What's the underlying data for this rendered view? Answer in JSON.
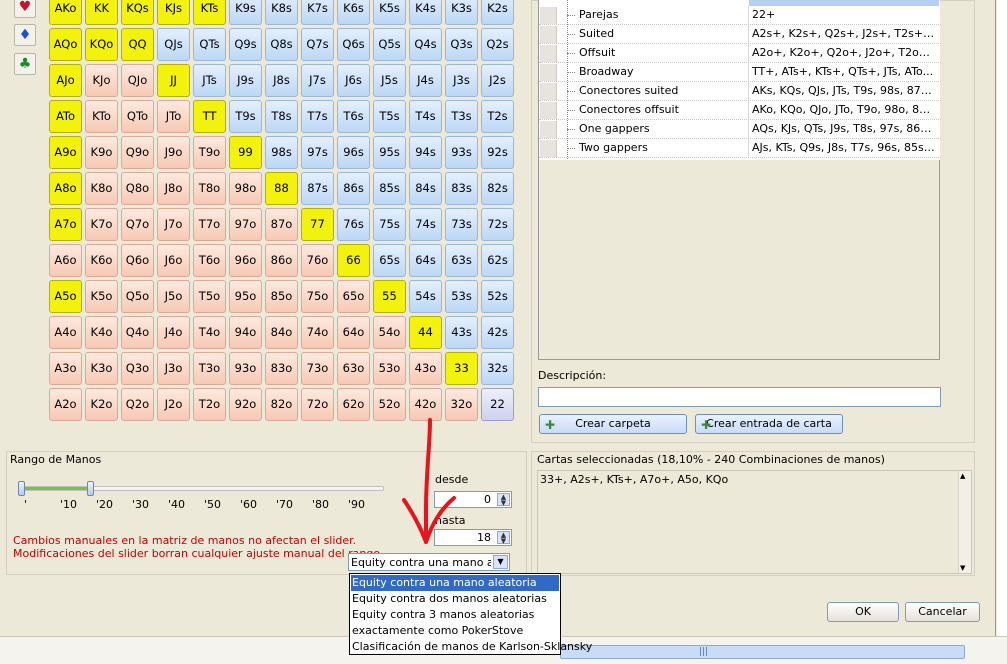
{
  "suit_buttons": [
    {
      "name": "hearts-icon",
      "glyph": "♥",
      "color": "#c8102e"
    },
    {
      "name": "diamonds-icon",
      "glyph": "♦",
      "color": "#1f4fd6"
    },
    {
      "name": "clubs-icon",
      "glyph": "♣",
      "color": "#1a8a2b"
    }
  ],
  "matrix": {
    "rows": [
      [
        "AKo",
        "KK",
        "KQs",
        "KJs",
        "KTs",
        "K9s",
        "K8s",
        "K7s",
        "K6s",
        "K5s",
        "K4s",
        "K3s",
        "K2s"
      ],
      [
        "AQo",
        "KQo",
        "QQ",
        "QJs",
        "QTs",
        "Q9s",
        "Q8s",
        "Q7s",
        "Q6s",
        "Q5s",
        "Q4s",
        "Q3s",
        "Q2s"
      ],
      [
        "AJo",
        "KJo",
        "QJo",
        "JJ",
        "JTs",
        "J9s",
        "J8s",
        "J7s",
        "J6s",
        "J5s",
        "J4s",
        "J3s",
        "J2s"
      ],
      [
        "ATo",
        "KTo",
        "QTo",
        "JTo",
        "TT",
        "T9s",
        "T8s",
        "T7s",
        "T6s",
        "T5s",
        "T4s",
        "T3s",
        "T2s"
      ],
      [
        "A9o",
        "K9o",
        "Q9o",
        "J9o",
        "T9o",
        "99",
        "98s",
        "97s",
        "96s",
        "95s",
        "94s",
        "93s",
        "92s"
      ],
      [
        "A8o",
        "K8o",
        "Q8o",
        "J8o",
        "T8o",
        "98o",
        "88",
        "87s",
        "86s",
        "85s",
        "84s",
        "83s",
        "82s"
      ],
      [
        "A7o",
        "K7o",
        "Q7o",
        "J7o",
        "T7o",
        "97o",
        "87o",
        "77",
        "76s",
        "75s",
        "74s",
        "73s",
        "72s"
      ],
      [
        "A6o",
        "K6o",
        "Q6o",
        "J6o",
        "T6o",
        "96o",
        "86o",
        "76o",
        "66",
        "65s",
        "64s",
        "63s",
        "62s"
      ],
      [
        "A5o",
        "K5o",
        "Q5o",
        "J5o",
        "T5o",
        "95o",
        "85o",
        "75o",
        "65o",
        "55",
        "54s",
        "53s",
        "52s"
      ],
      [
        "A4o",
        "K4o",
        "Q4o",
        "J4o",
        "T4o",
        "94o",
        "84o",
        "74o",
        "64o",
        "54o",
        "44",
        "43s",
        "42s"
      ],
      [
        "A3o",
        "K3o",
        "Q3o",
        "J3o",
        "T3o",
        "93o",
        "83o",
        "73o",
        "63o",
        "53o",
        "43o",
        "33",
        "32s"
      ],
      [
        "A2o",
        "K2o",
        "Q2o",
        "J2o",
        "T2o",
        "92o",
        "82o",
        "72o",
        "62o",
        "52o",
        "42o",
        "32o",
        "22"
      ]
    ],
    "selected": [
      "AKo",
      "KK",
      "KQs",
      "KJs",
      "KTs",
      "AQo",
      "KQo",
      "QQ",
      "AJo",
      "JJ",
      "ATo",
      "TT",
      "A9o",
      "99",
      "A8o",
      "88",
      "A7o",
      "77",
      "66",
      "A5o",
      "55",
      "44",
      "33"
    ],
    "colors": {
      "selected": "#f2f20c",
      "pair": "#d6daf2",
      "suited": "#c5dcf5",
      "offsuit": "#f8d0bd"
    }
  },
  "tree": {
    "rows": [
      {
        "name": "Parejas",
        "value": "22+"
      },
      {
        "name": "Suited",
        "value": "A2s+, K2s+, Q2s+, J2s+, T2s+, 9..."
      },
      {
        "name": "Offsuit",
        "value": "A2o+, K2o+, Q2o+, J2o+, T2o+, ..."
      },
      {
        "name": "Broadway",
        "value": "TT+, ATs+, KTs+, QTs+, JTs, ATo..."
      },
      {
        "name": "Conectores suited",
        "value": "AKs, KQs, QJs, JTs, T9s, 98s, 87s, ..."
      },
      {
        "name": "Conectores offsuit",
        "value": "AKo, KQo, QJo, JTo, T9o, 98o, 87o..."
      },
      {
        "name": "One gappers",
        "value": "AQs, KJs, QTs, J9s, T8s, 97s, 86s, ..."
      },
      {
        "name": "Two gappers",
        "value": "AJs, KTs, Q9s, J8s, T7s, 96s, 85s, ..."
      }
    ]
  },
  "description": {
    "label": "Descripción:",
    "value": ""
  },
  "buttons": {
    "create_folder": "Crear carpeta",
    "create_entry": "Crear entrada de carta",
    "ok": "OK",
    "cancel": "Cancelar"
  },
  "range": {
    "title": "Rango de Manos",
    "ticks": [
      "10",
      "20",
      "30",
      "40",
      "50",
      "60",
      "70",
      "80",
      "90"
    ],
    "from_label": "desde",
    "from_value": "0",
    "to_label": "hasta",
    "to_value": "18",
    "warning_line1": "Cambios manuales en la matriz de manos no afectan el slider.",
    "warning_line2": "Modificaciones del slider borran cualquier ajuste manual del rango."
  },
  "combo": {
    "selected": "Equity contra una mano al...",
    "options": [
      "Equity contra una mano aleatoria",
      "Equity contra dos manos aleatorias",
      "Equity contra 3 manos aleatorias",
      "exactamente como PokerStove",
      "Clasificación de manos de Karlson-Sklansky"
    ]
  },
  "selected_cards": {
    "title": "Cartas seleccionadas (18,10% - 240 Combinaciones de manos)",
    "text": "33+, A2s+, KTs+, A7o+, A5o, KQo"
  },
  "annotation_color": "#e8141c"
}
